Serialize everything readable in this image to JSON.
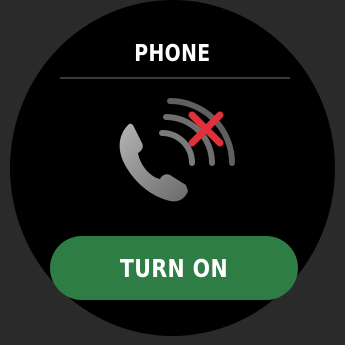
{
  "screen": {
    "title": "PHONE",
    "icon": "phone-disabled-icon",
    "button_label": "TURN ON"
  },
  "colors": {
    "background": "#000000",
    "button": "#2e7d45",
    "icon_gray": "#8a8a8a",
    "cross_red": "#e0303a",
    "text": "#ffffff"
  }
}
